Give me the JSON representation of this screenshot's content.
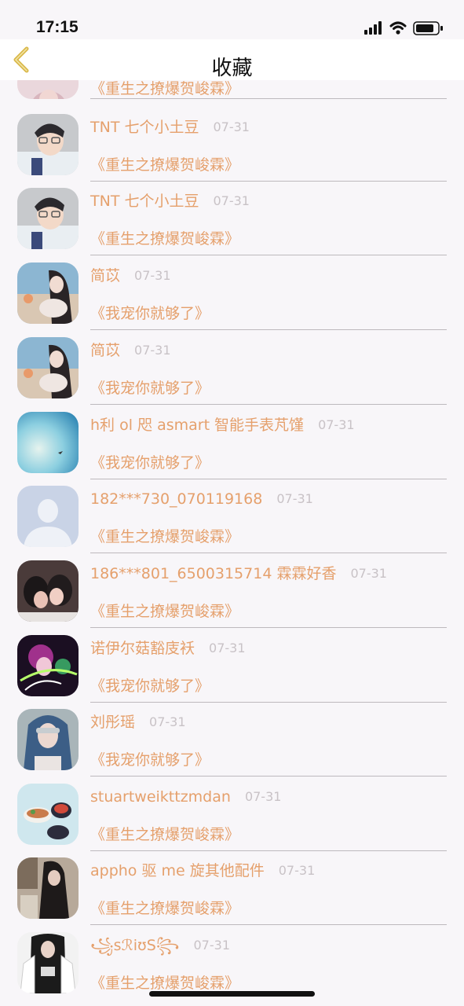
{
  "status": {
    "time": "17:15"
  },
  "nav": {
    "title": "收藏"
  },
  "list": {
    "top_title": "《重生之撩爆贺峻霖》",
    "items": [
      {
        "name": "TNT 七个小土豆",
        "date": "07-31",
        "title": "《重生之撩爆贺峻霖》"
      },
      {
        "name": "TNT 七个小土豆",
        "date": "07-31",
        "title": "《重生之撩爆贺峻霖》"
      },
      {
        "name": "简苡",
        "date": "07-31",
        "title": "《我宠你就够了》"
      },
      {
        "name": "简苡",
        "date": "07-31",
        "title": "《我宠你就够了》"
      },
      {
        "name": "h利 ol 咫 asmart 智能手表芃馑",
        "date": "07-31",
        "title": "《我宠你就够了》"
      },
      {
        "name": "182***730_070119168",
        "date": "07-31",
        "title": "《重生之撩爆贺峻霖》"
      },
      {
        "name": "186***801_6500315714 霖霖好香",
        "date": "07-31",
        "title": "《重生之撩爆贺峻霖》"
      },
      {
        "name": "诺伊尔菇豁庋袄",
        "date": "07-31",
        "title": "《我宠你就够了》"
      },
      {
        "name": "刘彤瑶",
        "date": "07-31",
        "title": "《我宠你就够了》"
      },
      {
        "name": "stuartweikttzmdan",
        "date": "07-31",
        "title": "《重生之撩爆贺峻霖》"
      },
      {
        "name": "appho 驱 me 旋其他配件",
        "date": "07-31",
        "title": "《重生之撩爆贺峻霖》"
      },
      {
        "name": "꧁sℛiʊS꧂",
        "date": "07-31",
        "title": "《重生之撩爆贺峻霖》"
      }
    ]
  },
  "colors": {
    "accent": "#e5a06c",
    "date": "#c8c2c6",
    "divider": "#bdb9bd",
    "background": "#f8f6f9",
    "back_arrow": "#d9b84a"
  }
}
